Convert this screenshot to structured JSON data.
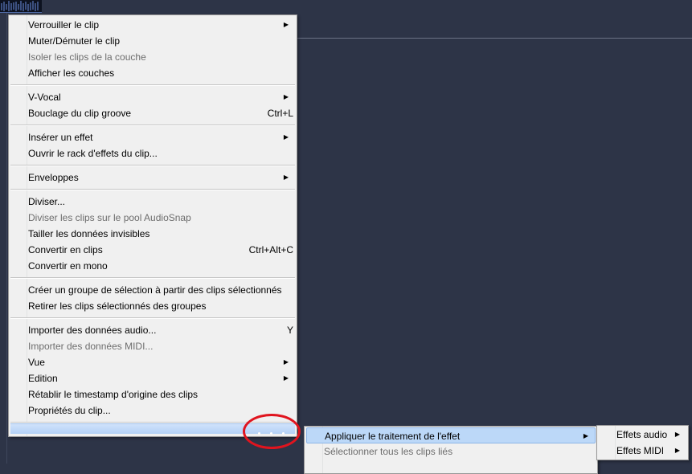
{
  "background": {
    "color": "#2d3447"
  },
  "main_menu": {
    "groups": [
      [
        {
          "label": "Verrouiller le clip",
          "submenu": true
        },
        {
          "label": "Muter/Démuter le clip"
        },
        {
          "label": "Isoler les clips de la couche",
          "disabled": true
        },
        {
          "label": "Afficher les couches"
        }
      ],
      [
        {
          "label": "V-Vocal",
          "submenu": true
        },
        {
          "label": "Bouclage du clip groove",
          "shortcut": "Ctrl+L"
        }
      ],
      [
        {
          "label": "Insérer un effet",
          "submenu": true
        },
        {
          "label": "Ouvrir le rack d'effets du clip..."
        }
      ],
      [
        {
          "label": "Enveloppes",
          "submenu": true
        }
      ],
      [
        {
          "label": "Diviser..."
        },
        {
          "label": "Diviser les clips sur le pool AudioSnap",
          "disabled": true
        },
        {
          "label": "Tailler les données invisibles"
        },
        {
          "label": "Convertir en clips",
          "shortcut": "Ctrl+Alt+C"
        },
        {
          "label": "Convertir en mono"
        }
      ],
      [
        {
          "label": "Créer un groupe de sélection à partir des clips sélectionnés"
        },
        {
          "label": "Retirer les clips sélectionnés des groupes"
        }
      ],
      [
        {
          "label": "Importer des données audio...",
          "shortcut": "Y"
        },
        {
          "label": "Importer des données MIDI...",
          "disabled": true
        },
        {
          "label": "Vue",
          "submenu": true
        },
        {
          "label": "Edition",
          "submenu": true
        },
        {
          "label": "Rétablir le timestamp d'origine des clips"
        },
        {
          "label": "Propriétés du clip..."
        }
      ]
    ]
  },
  "sub_menu": {
    "items": [
      {
        "label": "Appliquer le traitement de l'effet",
        "submenu": true,
        "highlighted": true
      },
      {
        "label": "Sélectionner tous les clips liés",
        "disabled": true
      }
    ]
  },
  "sub_sub_menu": {
    "items": [
      {
        "label": "Effets audio",
        "submenu": true
      },
      {
        "label": "Effets MIDI",
        "submenu": true
      }
    ]
  },
  "annotation": {
    "color": "#e0141e"
  }
}
